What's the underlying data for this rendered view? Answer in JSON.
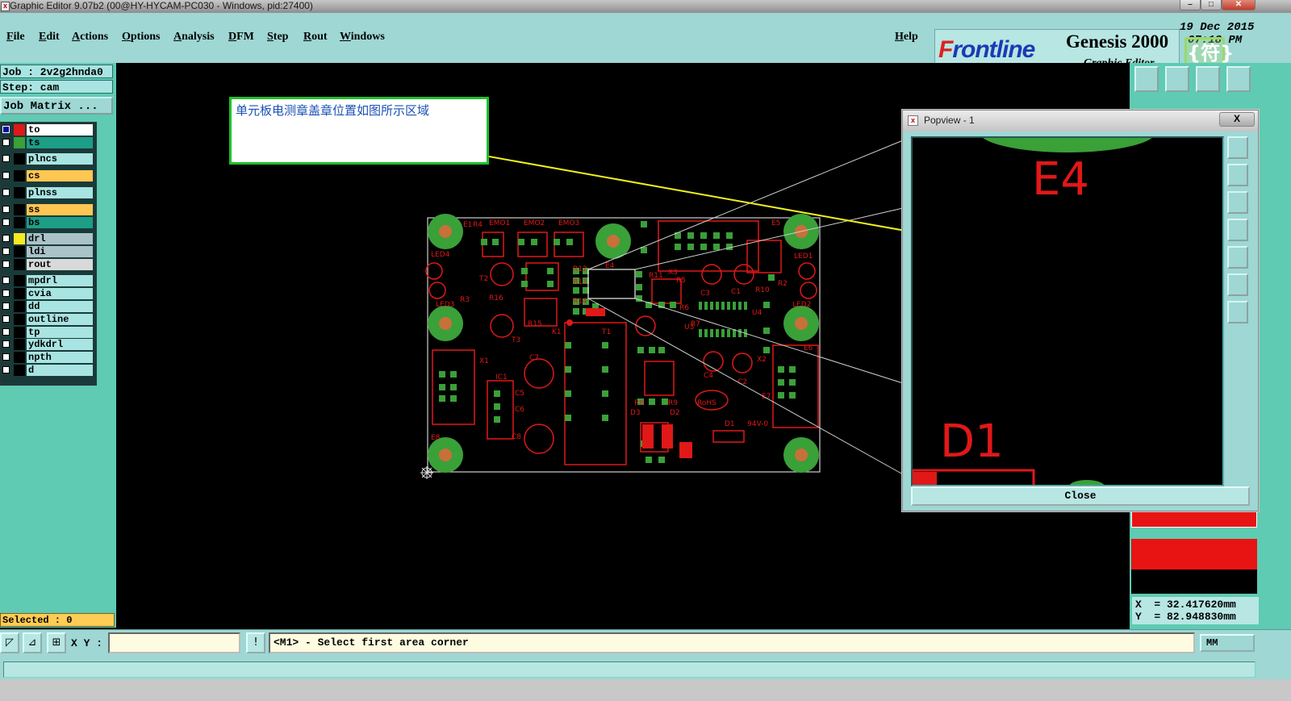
{
  "window": {
    "title": "Graphic Editor 9.07b2 (00@HY-HYCAM-PC030 - Windows, pid:27400)"
  },
  "menu": {
    "items": [
      "File",
      "Edit",
      "Actions",
      "Options",
      "Analysis",
      "DFM",
      "Step",
      "Rout",
      "Windows"
    ],
    "help": "Help"
  },
  "brand": {
    "logo_first": "F",
    "logo_rest": "rontline",
    "product": "Genesis 2000",
    "subtitle": "Graphic Editor",
    "date": "19 Dec 2015",
    "time": "07:18 PM",
    "watermark": "{符}"
  },
  "job": {
    "job_label": "Job : 2v2g2hnda0",
    "step_label": "Step: cam",
    "matrix_button": "Job Matrix ..."
  },
  "layers": [
    {
      "name": "to",
      "swatch": "#e01818",
      "bg": "#ffffff",
      "active": true
    },
    {
      "name": "ts",
      "swatch": "#3aa038",
      "bg": "#1d9e86",
      "active": false
    },
    {
      "name": "plncs",
      "swatch": "#000000",
      "bg": "#a8e4e1",
      "active": false
    },
    {
      "name": "cs",
      "swatch": "#000000",
      "bg": "#ffc652",
      "active": false
    },
    {
      "name": "plnss",
      "swatch": "#000000",
      "bg": "#a8e4e1",
      "active": false
    },
    {
      "name": "ss",
      "swatch": "#000000",
      "bg": "#ffc652",
      "active": false
    },
    {
      "name": "bs",
      "swatch": "#000000",
      "bg": "#1d9e86",
      "active": false
    },
    {
      "name": "drl",
      "swatch": "#f8e820",
      "bg": "#a9c3c8",
      "active": false
    },
    {
      "name": "ldi",
      "swatch": "#000000",
      "bg": "#a9c3c8",
      "active": false
    },
    {
      "name": "rout",
      "swatch": "#000000",
      "bg": "#d8dada",
      "active": false
    },
    {
      "name": "mpdrl",
      "swatch": "#000000",
      "bg": "#a8e4e1",
      "active": false
    },
    {
      "name": "cvia",
      "swatch": "#000000",
      "bg": "#a8e4e1",
      "active": false
    },
    {
      "name": "dd",
      "swatch": "#000000",
      "bg": "#a8e4e1",
      "active": false
    },
    {
      "name": "outline",
      "swatch": "#000000",
      "bg": "#a8e4e1",
      "active": false
    },
    {
      "name": "tp",
      "swatch": "#000000",
      "bg": "#a8e4e1",
      "active": false
    },
    {
      "name": "ydkdrl",
      "swatch": "#000000",
      "bg": "#a8e4e1",
      "active": false
    },
    {
      "name": "npth",
      "swatch": "#000000",
      "bg": "#a8e4e1",
      "active": false
    },
    {
      "name": "d",
      "swatch": "#000000",
      "bg": "#a8e4e1",
      "active": false
    }
  ],
  "selected_label": "Selected : 0",
  "annotation": "单元板电测章盖章位置如图所示区域",
  "board": {
    "silkscreen_labels": [
      "E1",
      "R4",
      "EMO1",
      "EMO2",
      "EMO3",
      "E5",
      "LED4",
      "LED1",
      "T2",
      "R12",
      "R13",
      "R14",
      "R16",
      "R15",
      "R3",
      "LED3",
      "T3",
      "K1",
      "T1",
      "R11",
      "R5",
      "X3",
      "C3",
      "C1",
      "R10",
      "R2",
      "R6",
      "U4",
      "U3",
      "R7",
      "E4",
      "LED2",
      "E6",
      "C4",
      "C2",
      "X2",
      "X1",
      "C7",
      "IC1",
      "C5",
      "C6",
      "C8",
      "R8",
      "R9",
      "D3",
      "D2",
      "RoHS",
      "D1",
      "94V-0",
      "E8",
      "E7"
    ]
  },
  "popview": {
    "title": "Popview - 1",
    "close_x": "X",
    "close_button": "Close",
    "zoom_labels": [
      "E4",
      "D1"
    ]
  },
  "coords": {
    "x": "X  = 32.417620mm",
    "y": "Y  = 82.948830mm"
  },
  "bottom": {
    "xy_label": "X Y :",
    "xy_value": "",
    "prompt": "<M1> - Select first area corner",
    "units": "MM"
  },
  "colors": {
    "panel": "#5fcbb3",
    "menubar": "#9ed7d4",
    "copper": "#e01818",
    "pad": "#3aa038",
    "pad_center": "#c8703a",
    "annotation_arrow": "#f0f020"
  }
}
